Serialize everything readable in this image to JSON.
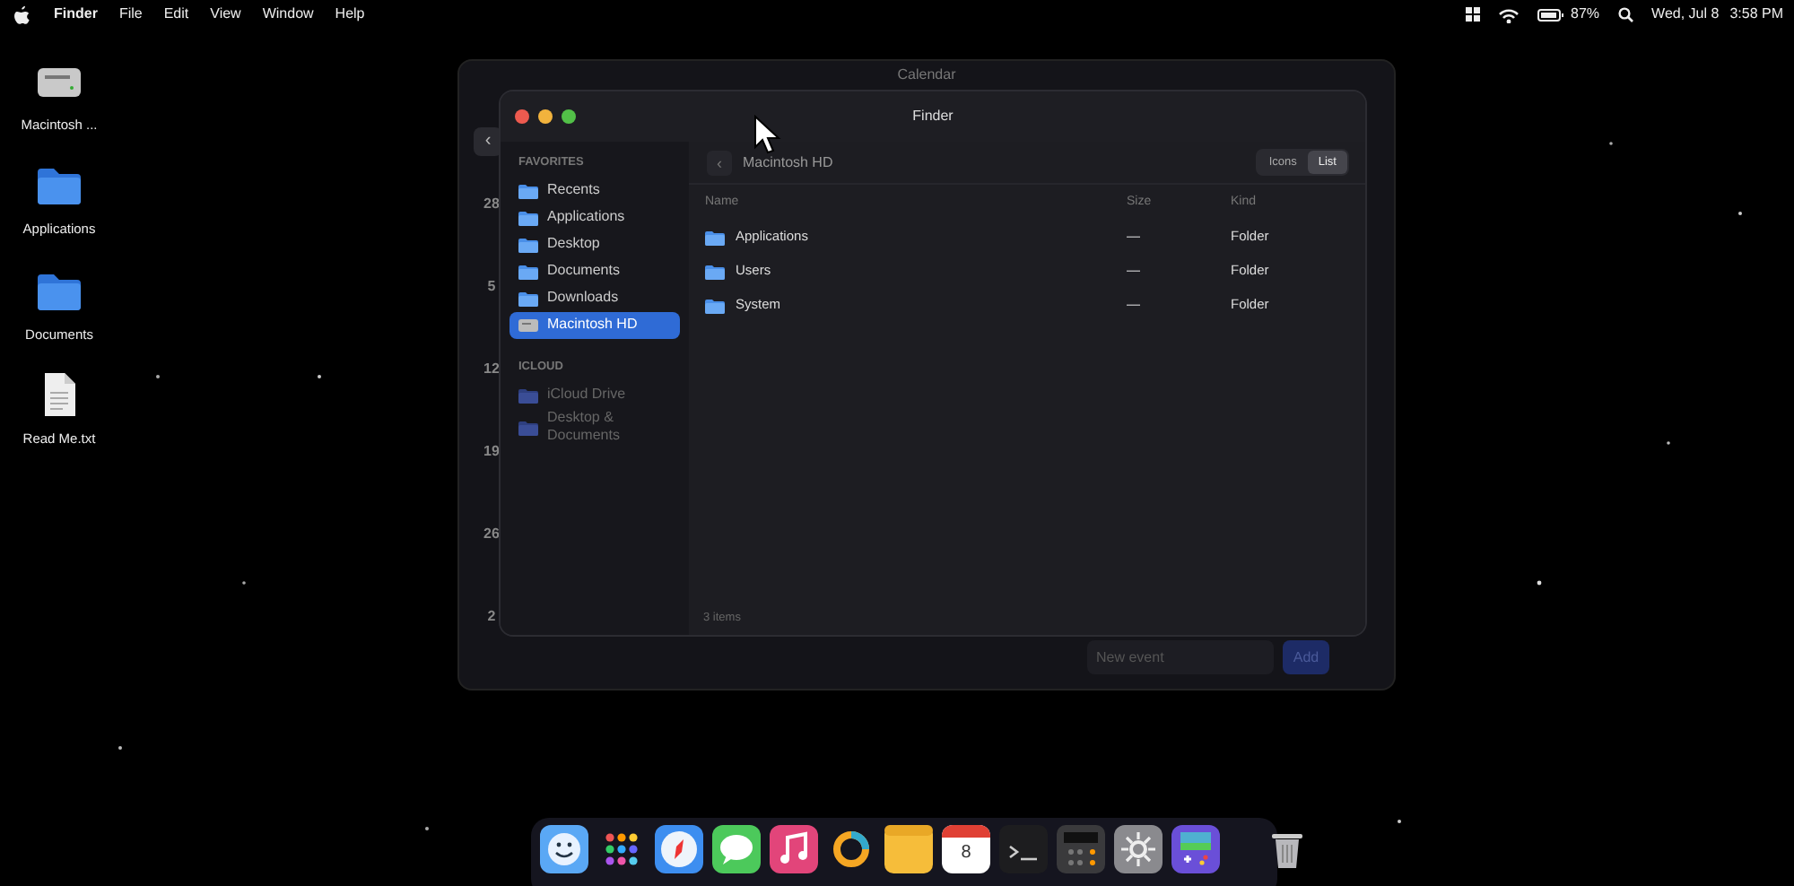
{
  "menu_bar": {
    "app": "Finder",
    "menus": [
      "File",
      "Edit",
      "View",
      "Window",
      "Help"
    ],
    "battery": "87%",
    "date": "Wed, Jul 8",
    "time": "3:58 PM"
  },
  "desktop_icons": [
    {
      "label": "Macintosh ...",
      "kind": "disk"
    },
    {
      "label": "Applications",
      "kind": "folder"
    },
    {
      "label": "Documents",
      "kind": "folder"
    },
    {
      "label": "Read Me.txt",
      "kind": "file"
    }
  ],
  "calendar": {
    "title": "Calendar",
    "back": "‹",
    "week_dates": [
      "28",
      "5",
      "12",
      "19",
      "26",
      "2"
    ],
    "new_event_placeholder": "New event",
    "add_button": "Add"
  },
  "finder": {
    "title": "Finder",
    "sidebar": [
      {
        "heading": "FAVORITES",
        "items": [
          {
            "label": "Recents",
            "kind": "folder",
            "selected": false,
            "disabled": false
          },
          {
            "label": "Applications",
            "kind": "folder",
            "selected": false,
            "disabled": false
          },
          {
            "label": "Desktop",
            "kind": "folder",
            "selected": false,
            "disabled": false
          },
          {
            "label": "Documents",
            "kind": "folder",
            "selected": false,
            "disabled": false
          },
          {
            "label": "Downloads",
            "kind": "folder",
            "selected": false,
            "disabled": false
          },
          {
            "label": "Macintosh HD",
            "kind": "disk",
            "selected": true,
            "disabled": false
          }
        ]
      },
      {
        "heading": "ICLOUD",
        "items": [
          {
            "label": "iCloud Drive",
            "kind": "folder",
            "selected": false,
            "disabled": true
          },
          {
            "label": "Desktop & Documents",
            "kind": "folder",
            "selected": false,
            "disabled": true
          }
        ]
      }
    ],
    "back": "‹",
    "path": "Macintosh HD",
    "view_modes": [
      {
        "label": "Icons",
        "selected": false
      },
      {
        "label": "List",
        "selected": true
      }
    ],
    "columns": [
      "Name",
      "Size",
      "Kind"
    ],
    "rows": [
      {
        "name": "Applications",
        "size": "—",
        "kind_column": "Folder"
      },
      {
        "name": "Users",
        "size": "—",
        "kind_column": "Folder"
      },
      {
        "name": "System",
        "size": "—",
        "kind_column": "Folder"
      }
    ],
    "status": "3 items"
  },
  "dock": [
    {
      "kind": "finder"
    },
    {
      "kind": "launchpad"
    },
    {
      "kind": "safari"
    },
    {
      "kind": "messages"
    },
    {
      "kind": "music"
    },
    {
      "kind": "ring"
    },
    {
      "kind": "notes"
    },
    {
      "kind": "calendar",
      "text": "8"
    },
    {
      "kind": "terminal"
    },
    {
      "kind": "calculator"
    },
    {
      "kind": "settings"
    },
    {
      "kind": "game"
    },
    {
      "kind": "separator"
    },
    {
      "kind": "trash"
    }
  ]
}
